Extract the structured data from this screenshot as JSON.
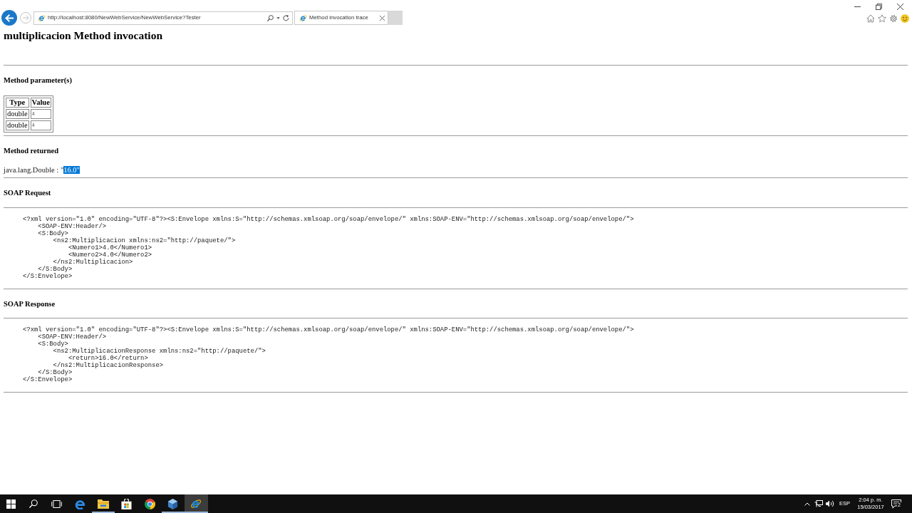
{
  "browser": {
    "back_disabled": false,
    "forward_disabled": true,
    "address": "http://localhost:8080/NewWebService/NewWebService?Tester",
    "tabs": [
      {
        "title": "Method invocation trace",
        "selected": true
      }
    ]
  },
  "page": {
    "title": "multiplicacion Method invocation",
    "sections": [
      {
        "kind": "parameters",
        "heading": "Method parameter(s)",
        "table": {
          "columns": [
            "Type",
            "Value"
          ],
          "rows": [
            [
              "double",
              "4"
            ],
            [
              "double",
              "4"
            ]
          ]
        }
      },
      {
        "kind": "returned",
        "heading": "Method returned",
        "parts": [
          {
            "text": "java.lang.Double : \"",
            "selected": false
          },
          {
            "text": "16.0\"",
            "selected": true
          }
        ]
      },
      {
        "kind": "xml",
        "heading": "SOAP Request",
        "xml": "<?xml version=\"1.0\" encoding=\"UTF-8\"?><S:Envelope xmlns:S=\"http://schemas.xmlsoap.org/soap/envelope/\" xmlns:SOAP-ENV=\"http://schemas.xmlsoap.org/soap/envelope/\">\n    <SOAP-ENV:Header/>\n    <S:Body>\n        <ns2:Multiplicacion xmlns:ns2=\"http://paquete/\">\n            <Numero1>4.0</Numero1>\n            <Numero2>4.0</Numero2>\n        </ns2:Multiplicacion>\n    </S:Body>\n</S:Envelope>"
      },
      {
        "kind": "xml",
        "heading": "SOAP Response",
        "xml": "<?xml version=\"1.0\" encoding=\"UTF-8\"?><S:Envelope xmlns:S=\"http://schemas.xmlsoap.org/soap/envelope/\" xmlns:SOAP-ENV=\"http://schemas.xmlsoap.org/soap/envelope/\">\n    <SOAP-ENV:Header/>\n    <S:Body>\n        <ns2:MultiplicacionResponse xmlns:ns2=\"http://paquete/\">\n            <return>16.0</return>\n        </ns2:MultiplicacionResponse>\n    </S:Body>\n</S:Envelope>"
      }
    ]
  },
  "taskbar": {
    "items": [
      {
        "kind": "start"
      },
      {
        "kind": "search"
      },
      {
        "kind": "task-view"
      },
      {
        "kind": "edge",
        "running": false,
        "selected": false
      },
      {
        "kind": "explorer",
        "running": true,
        "selected": false
      },
      {
        "kind": "store",
        "running": false,
        "selected": false
      },
      {
        "kind": "chrome",
        "running": false,
        "selected": false
      },
      {
        "kind": "cube",
        "running": true,
        "selected": false
      },
      {
        "kind": "ie",
        "running": true,
        "selected": true
      }
    ],
    "tray": {
      "language": "ESP",
      "time": "2:04 p. m.",
      "date": "15/03/2017",
      "notifications": "2"
    }
  }
}
